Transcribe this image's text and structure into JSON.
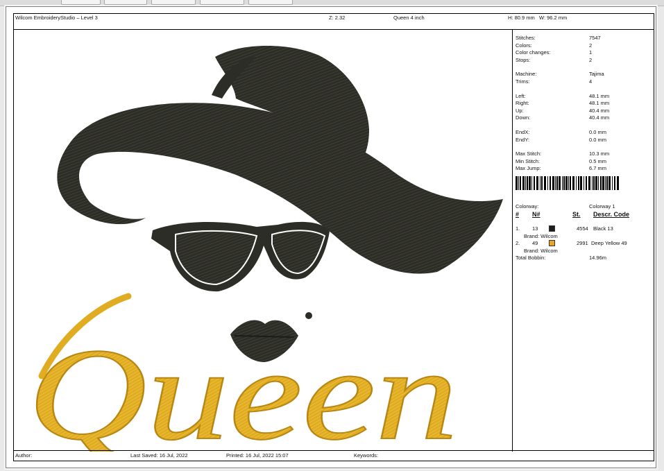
{
  "header": {
    "app_title": "Wilcom EmbroideryStudio – Level 3",
    "zoom": "Z: 2.32",
    "design_name": "Queen 4 inch",
    "dimensions": "H: 80.9 mm   W: 96.2 mm"
  },
  "design_text": "Queen",
  "stats": [
    {
      "label": "Stitches:",
      "value": "7547"
    },
    {
      "label": "Colors:",
      "value": "2"
    },
    {
      "label": "Color changes:",
      "value": "1"
    },
    {
      "label": "Stops:",
      "value": "2"
    },
    {
      "label": "Machine:",
      "value": "Tajima"
    },
    {
      "label": "Trims:",
      "value": "4"
    },
    {
      "label": "Left:",
      "value": "48.1 mm"
    },
    {
      "label": "Right:",
      "value": "48.1 mm"
    },
    {
      "label": "Up:",
      "value": "40.4 mm"
    },
    {
      "label": "Down:",
      "value": "40.4 mm"
    },
    {
      "label": "EndX:",
      "value": "0.0 mm"
    },
    {
      "label": "EndY:",
      "value": "0.0 mm"
    },
    {
      "label": "Max Stitch:",
      "value": "10.3 mm"
    },
    {
      "label": "Min Stitch:",
      "value": "0.5 mm"
    },
    {
      "label": "Max Jump:",
      "value": "6.7 mm"
    }
  ],
  "colorway": {
    "label": "Colorway:",
    "value": "Colorway 1"
  },
  "color_table": {
    "headers": [
      "#",
      "N#",
      "St.",
      "Descr. Code"
    ],
    "rows": [
      {
        "index": "1.",
        "n": "13",
        "swatch": "#1e1e1e",
        "stitches": "4554",
        "descr": "Black 13",
        "brand": "Brand: Wilcom"
      },
      {
        "index": "2.",
        "n": "49",
        "swatch": "#e8a52a",
        "stitches": "2991",
        "descr": "Deep Yellow 49",
        "brand": "Brand: Wilcom"
      }
    ],
    "total_bobbin": {
      "label": "Total Bobbin:",
      "value": "14.96m"
    }
  },
  "footer": {
    "author": "Author:",
    "last_saved": "Last Saved: 16 Jul, 2022",
    "printed": "Printed: 16 Jul, 2022 15:07",
    "keywords": "Keywords:"
  },
  "colors": {
    "thread_black": "#2a2a24",
    "thread_yellow": "#e3b026"
  }
}
